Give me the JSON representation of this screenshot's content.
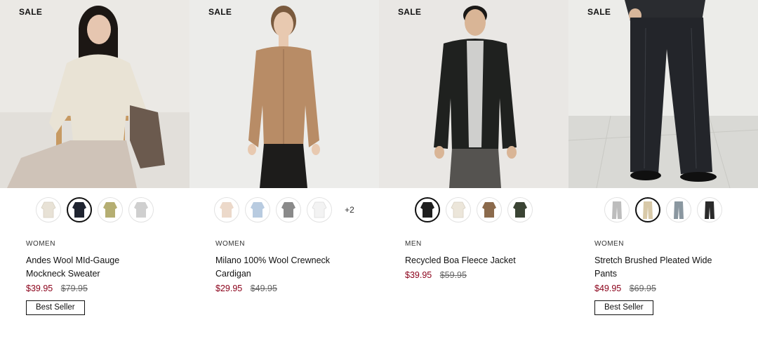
{
  "products": [
    {
      "sale_label": "SALE",
      "gender": "WOMEN",
      "name_line1": "Andes Wool MId-Gauge",
      "name_line2": "Mockneck Sweater",
      "price": "$39.95",
      "original_price": "$79.95",
      "badge": "Best Seller",
      "swatch_colors": [
        "#e8e2d6",
        "#1f2430",
        "#b5ae72",
        "#cfcfcf"
      ],
      "selected_swatch": 1,
      "more_colors": ""
    },
    {
      "sale_label": "SALE",
      "gender": "WOMEN",
      "name_line1": "Milano 100% Wool Crewneck",
      "name_line2": "Cardigan",
      "price": "$29.95",
      "original_price": "$49.95",
      "badge": "",
      "swatch_colors": [
        "#ecd9ca",
        "#b8cbe0",
        "#8a8a8a",
        "#f3f3f3"
      ],
      "selected_swatch": -1,
      "more_colors": "+2"
    },
    {
      "sale_label": "SALE",
      "gender": "MEN",
      "name_line1": "Recycled Boa Fleece Jacket",
      "name_line2": "",
      "price": "$39.95",
      "original_price": "$59.95",
      "badge": "",
      "swatch_colors": [
        "#1e1e1e",
        "#ece6da",
        "#8b6a4c",
        "#3b4434"
      ],
      "selected_swatch": 0,
      "more_colors": ""
    },
    {
      "sale_label": "SALE",
      "gender": "WOMEN",
      "name_line1": "Stretch Brushed Pleated Wide",
      "name_line2": "Pants",
      "price": "$49.95",
      "original_price": "$69.95",
      "badge": "Best Seller",
      "swatch_colors": [
        "#bdbdbd",
        "#d8c9a8",
        "#8a97a0",
        "#2a2a2a"
      ],
      "selected_swatch": 1,
      "more_colors": ""
    }
  ],
  "colors": {
    "sale_price": "#8a0019",
    "text": "#111111"
  }
}
